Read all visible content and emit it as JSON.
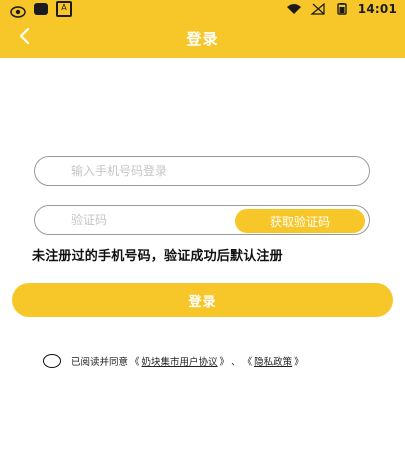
{
  "status_bar": {
    "time": "14:01",
    "left_icons": [
      "shield-icon",
      "app-square-icon",
      "a-icon"
    ],
    "right_icons": [
      "wifi-icon",
      "signal-icon",
      "battery-icon"
    ]
  },
  "header": {
    "title": "登录",
    "back_icon": "chevron-left-icon"
  },
  "form": {
    "phone": {
      "placeholder": "输入手机号码登录",
      "value": ""
    },
    "code": {
      "placeholder": "验证码",
      "value": ""
    },
    "get_code_label": "获取验证码",
    "note": "未注册过的手机号码，验证成功后默认注册",
    "login_label": "登录"
  },
  "agreement": {
    "prefix": "已阅读并同意",
    "user_agreement": "奶块集市用户协议",
    "separator": "、",
    "privacy_policy": "隐私政策",
    "open_quote": "《",
    "close_quote": "》"
  },
  "colors": {
    "accent": "#f7c72a",
    "background": "#ffffff",
    "text": "#111111",
    "placeholder": "#c5c5c5"
  }
}
